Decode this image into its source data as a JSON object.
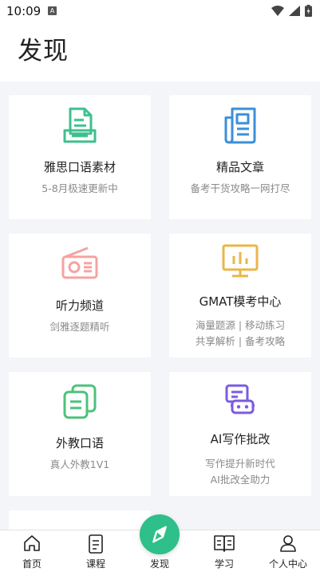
{
  "status_bar": {
    "time": "10:09",
    "a_badge": "A"
  },
  "header": {
    "title": "发现"
  },
  "cards": [
    {
      "title": "雅思口语素材",
      "subtitle": "5-8月极速更新中",
      "icon": "document-stack-icon",
      "color": "#3fbf8f"
    },
    {
      "title": "精品文章",
      "subtitle": "备考干货攻略一网打尽",
      "icon": "newspaper-icon",
      "color": "#3b8fd9"
    },
    {
      "title": "听力频道",
      "subtitle": "剑雅逐题精听",
      "icon": "radio-icon",
      "color": "#f4a3a3"
    },
    {
      "title": "GMAT模考中心",
      "subtitle_line1": "海量题源 | 移动练习",
      "subtitle_line2": "共享解析 | 备考攻略",
      "icon": "presentation-board-icon",
      "color": "#eab64a"
    },
    {
      "title": "外教口语",
      "subtitle": "真人外教1V1",
      "icon": "copy-docs-icon",
      "color": "#4cc27a"
    },
    {
      "title": "AI写作批改",
      "subtitle_line1": "写作提升新时代",
      "subtitle_line2": "AI批改全助力",
      "icon": "robot-icon",
      "color": "#7a5ce0"
    }
  ],
  "tabbar": {
    "items": [
      {
        "label": "首页",
        "icon": "home-icon"
      },
      {
        "label": "课程",
        "icon": "course-book-icon"
      },
      {
        "label": "发现",
        "icon": "compass-icon",
        "active": true
      },
      {
        "label": "学习",
        "icon": "open-book-icon"
      },
      {
        "label": "个人中心",
        "icon": "person-icon"
      }
    ],
    "accent": "#2ebf8a"
  }
}
